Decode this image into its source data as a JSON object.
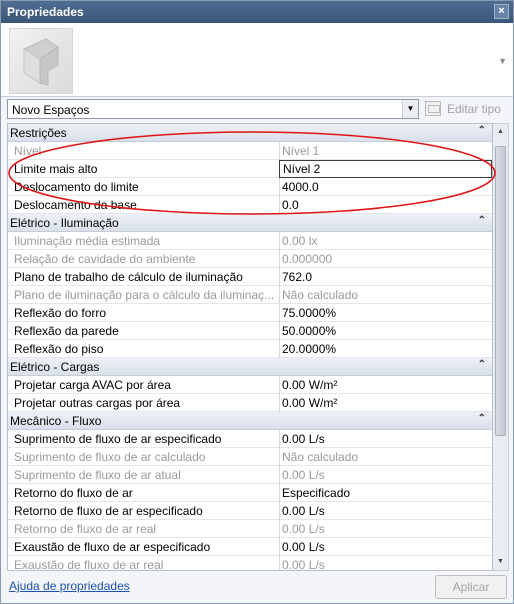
{
  "panel": {
    "title": "Propriedades",
    "close_glyph": "×"
  },
  "type_selector": {
    "value": "Novo Espaços",
    "edit_type_label": "Editar tipo"
  },
  "icons": {
    "close": "close-icon",
    "dropdown": "chevron-down-icon",
    "edit_type": "edit-type-icon",
    "collapse": "collapse-icon"
  },
  "categories": [
    {
      "label": "Restrições",
      "rows": [
        {
          "name": "Nível",
          "value": "Nível 1",
          "dim": true
        },
        {
          "name": "Limite mais alto",
          "value": "Nível 2",
          "dim": false,
          "boxed": true
        },
        {
          "name": "Deslocamento do limite",
          "value": "4000.0",
          "dim": false
        },
        {
          "name": "Deslocamento da base",
          "value": "0.0",
          "dim": false
        }
      ]
    },
    {
      "label": "Elétrico - Iluminação",
      "rows": [
        {
          "name": "Iluminação média estimada",
          "value": "0.00 lx",
          "dim": true
        },
        {
          "name": "Relação de cavidade do ambiente",
          "value": "0.000000",
          "dim": true
        },
        {
          "name": "Plano de trabalho de cálculo de iluminação",
          "value": "762.0",
          "dim": false
        },
        {
          "name": "Plano de iluminação para o cálculo da iluminaç...",
          "value": "Não calculado",
          "dim": true
        },
        {
          "name": "Reflexão do forro",
          "value": "75.0000%",
          "dim": false
        },
        {
          "name": "Reflexão da parede",
          "value": "50.0000%",
          "dim": false
        },
        {
          "name": "Reflexão do piso",
          "value": "20.0000%",
          "dim": false
        }
      ]
    },
    {
      "label": "Elétrico - Cargas",
      "rows": [
        {
          "name": "Projetar carga AVAC por área",
          "value": "0.00 W/m²",
          "dim": false
        },
        {
          "name": "Projetar outras cargas por área",
          "value": "0.00 W/m²",
          "dim": false
        }
      ]
    },
    {
      "label": "Mecânico - Fluxo",
      "rows": [
        {
          "name": "Suprimento de fluxo de ar especificado",
          "value": "0.00 L/s",
          "dim": false
        },
        {
          "name": "Suprimento de fluxo de ar calculado",
          "value": "Não calculado",
          "dim": true
        },
        {
          "name": "Suprimento de fluxo de ar atual",
          "value": "0.00 L/s",
          "dim": true
        },
        {
          "name": "Retorno do fluxo de ar",
          "value": "Especificado",
          "dim": false
        },
        {
          "name": "Retorno de fluxo de ar especificado",
          "value": "0.00 L/s",
          "dim": false
        },
        {
          "name": "Retorno de fluxo de ar real",
          "value": "0.00 L/s",
          "dim": true
        },
        {
          "name": "Exaustão de fluxo de ar especificado",
          "value": "0.00 L/s",
          "dim": false
        },
        {
          "name": "Exaustão de fluxo de ar real",
          "value": "0.00 L/s",
          "dim": true
        }
      ]
    }
  ],
  "annotation_color": "#e01515",
  "footer": {
    "help_link": "Ajuda de propriedades",
    "apply_button": "Aplicar"
  }
}
